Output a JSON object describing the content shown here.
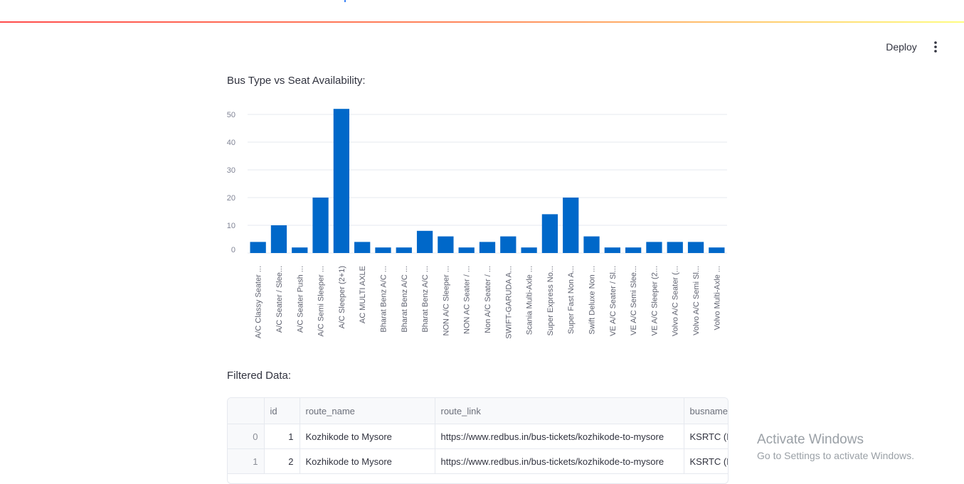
{
  "header": {
    "deploy_label": "Deploy",
    "menu_icon": "vertical-ellipsis-icon"
  },
  "chart_section": {
    "title": "Bus Type vs Seat Availability:"
  },
  "chart_data": {
    "type": "bar",
    "title": "Bus Type vs Seat Availability:",
    "xlabel": "",
    "ylabel": "",
    "ylim": [
      0,
      53
    ],
    "yticks": [
      0,
      10,
      20,
      30,
      40,
      50
    ],
    "grid": true,
    "bar_color": "#0068c9",
    "categories": [
      "A/C Classy Seater ...",
      "A/C Seater / Slee...",
      "A/C Seater Push ...",
      "A/C Semi Sleeper ...",
      "A/C Sleeper (2+1)",
      "AC MULTI AXLE",
      "Bharat Benz A/C ...",
      "Bharat Benz A/C ...",
      "Bharat Benz A/C ...",
      "NON A/C Sleeper ...",
      "NON AC Seater / ...",
      "Non A/C Seater / ...",
      "SWIFT-GARUDA A...",
      "Scania Multi-Axle ...",
      "Super Express No...",
      "Super Fast Non A...",
      "Swift Deluxe Non ...",
      "VE A/C Seater / Sl...",
      "VE A/C Semi Slee...",
      "VE A/C Sleeper (2...",
      "Volvo A/C Seater (...",
      "Volvo A/C Semi Sl...",
      "Volvo Multi-Axle ..."
    ],
    "values": [
      4,
      10,
      2,
      20,
      52,
      4,
      2,
      2,
      8,
      6,
      2,
      4,
      6,
      2,
      14,
      20,
      6,
      2,
      2,
      4,
      4,
      4,
      2
    ]
  },
  "data_section": {
    "title": "Filtered Data:",
    "columns": [
      "",
      "id",
      "route_name",
      "route_link",
      "busname"
    ],
    "rows": [
      [
        "0",
        "1",
        "Kozhikode to Mysore",
        "https://www.redbus.in/bus-tickets/kozhikode-to-mysore",
        "KSRTC (K"
      ],
      [
        "1",
        "2",
        "Kozhikode to Mysore",
        "https://www.redbus.in/bus-tickets/kozhikode-to-mysore",
        "KSRTC (K"
      ]
    ]
  },
  "watermark": {
    "title": "Activate Windows",
    "subtitle": "Go to Settings to activate Windows."
  }
}
